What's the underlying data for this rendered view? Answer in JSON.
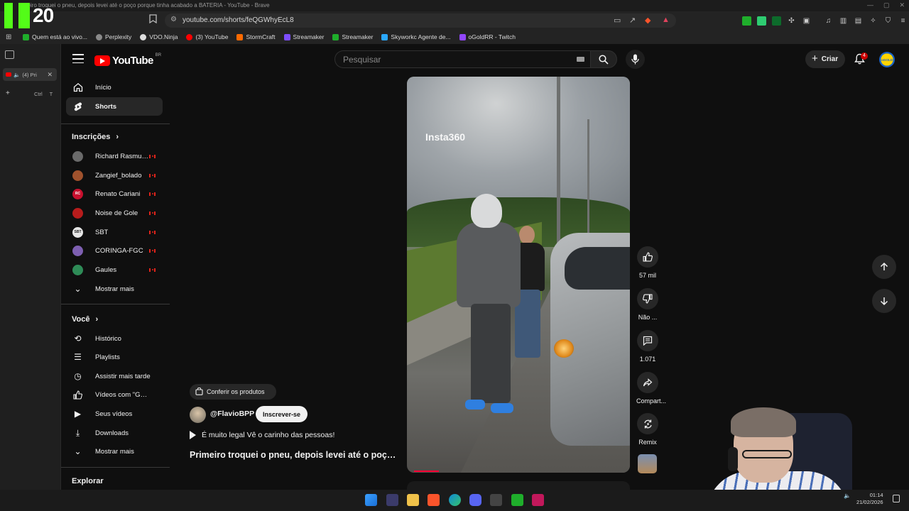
{
  "browser": {
    "window_title": "Primeiro troquei o pneu, depois levei até o poço porque tinha acabado a BATERIA - YouTube - Brave",
    "url": "youtube.com/shorts/feQGWhyEcL8",
    "overlay_counter": "20",
    "vertical_tab_label": "(4) Pri",
    "new_tab_hint": "Ctrl T",
    "bookmarks": [
      {
        "label": "Quem está ao vivo...",
        "color": "#1fae2b"
      },
      {
        "label": "Perplexity",
        "color": "#8a8a8a"
      },
      {
        "label": "VDO.Ninja",
        "color": "#dddddd"
      },
      {
        "label": "(3) YouTube",
        "color": "#ff0000"
      },
      {
        "label": "StormCraft",
        "color": "#ff6a00"
      },
      {
        "label": "Streamaker",
        "color": "#7d4dff"
      },
      {
        "label": "Streamaker",
        "color": "#1fae2b"
      },
      {
        "label": "Skyworkc Agente de...",
        "color": "#2aa8ff"
      },
      {
        "label": "oGoldRR - Twitch",
        "color": "#9146ff"
      }
    ]
  },
  "header": {
    "logo_text": "YouTube",
    "country_code": "BR",
    "search_placeholder": "Pesquisar",
    "create_label": "Criar",
    "notification_count": "4",
    "avatar_text": "oGOLD"
  },
  "sidebar": {
    "main": [
      {
        "label": "Início",
        "icon": "home-icon"
      },
      {
        "label": "Shorts",
        "icon": "shorts-icon",
        "active": true
      }
    ],
    "subscriptions_title": "Inscrições",
    "subscriptions": [
      {
        "label": "Richard Rasmus...",
        "color": "#6a6a6a",
        "badge": ""
      },
      {
        "label": "Zangief_bolado",
        "color": "#a0522d",
        "badge": ""
      },
      {
        "label": "Renato Cariani",
        "color": "#c8102e",
        "badge": "RC"
      },
      {
        "label": "Noise de Gole",
        "color": "#b71c1c",
        "badge": ""
      },
      {
        "label": "SBT",
        "color": "#e6e6e6",
        "badge": "SBT"
      },
      {
        "label": "CORINGA-FGC",
        "color": "#7d5fb0",
        "badge": ""
      },
      {
        "label": "Gaules",
        "color": "#2e8b57",
        "badge": ""
      }
    ],
    "show_more": "Mostrar mais",
    "you_title": "Você",
    "you_items": [
      {
        "label": "Histórico",
        "icon": "history-icon"
      },
      {
        "label": "Playlists",
        "icon": "playlists-icon"
      },
      {
        "label": "Assistir mais tarde",
        "icon": "watch-later-icon"
      },
      {
        "label": "Vídeos com \"Gostei\"",
        "icon": "like-icon"
      },
      {
        "label": "Seus vídeos",
        "icon": "your-videos-icon"
      },
      {
        "label": "Downloads",
        "icon": "download-icon"
      }
    ],
    "show_more_2": "Mostrar mais",
    "explore_title": "Explorar"
  },
  "short": {
    "watermark": "Insta360",
    "products_label": "Conferir os produtos",
    "channel": "@FlavioBPP",
    "subscribe_label": "Inscrever-se",
    "audio_text": "É muito legal Vê o carinho das pessoas!",
    "title": "Primeiro troquei o pneu, depois levei até o poço porque tinha acabado a BATERIA",
    "progress": 0.11,
    "actions": {
      "likes": "57 mil",
      "dislike": "Não ...",
      "comments": "1.071",
      "share": "Compart...",
      "remix": "Remix"
    }
  },
  "taskbar": {
    "time": "01:14",
    "date": "21/02/2026"
  }
}
